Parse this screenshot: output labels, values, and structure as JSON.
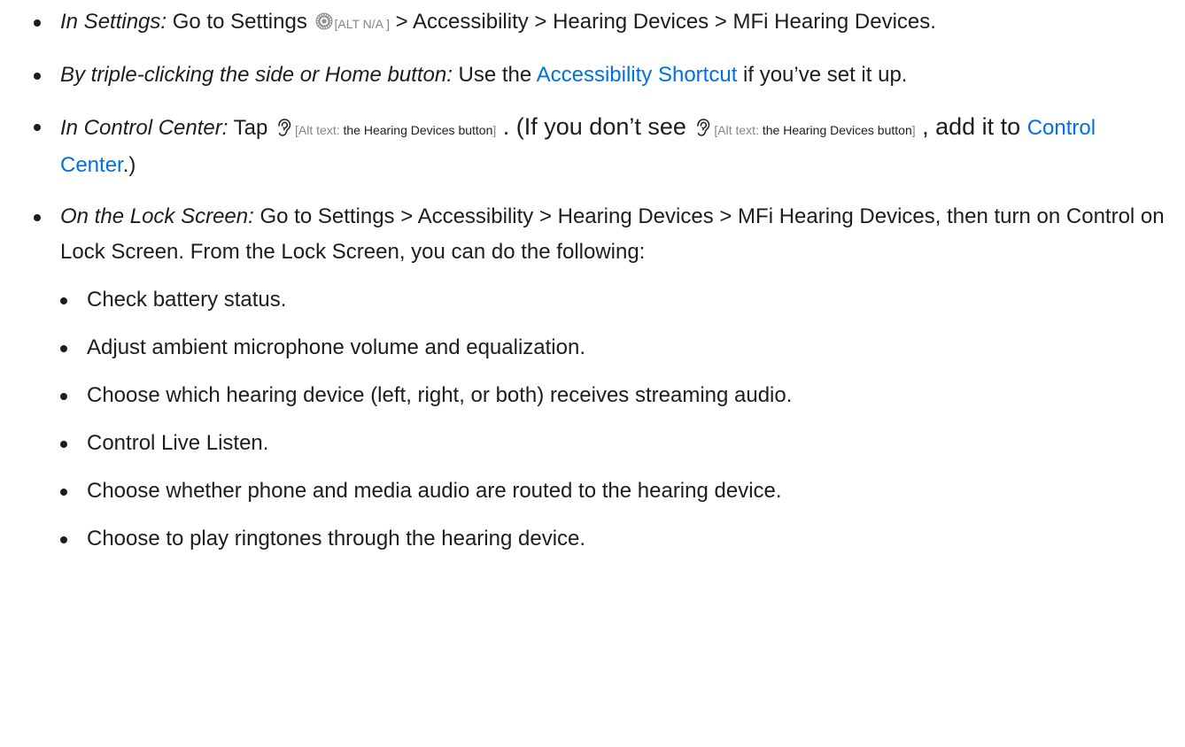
{
  "items": [
    {
      "lead": "In Settings:",
      "text_before": " Go to Settings ",
      "icon": "settings-gear-icon",
      "alt": "[ALT N/A ]",
      "text_after": " > Accessibility > Hearing Devices > MFi Hearing Devices."
    },
    {
      "lead": "By triple-clicking the side or Home button:",
      "text_before": " Use the ",
      "link": "Accessibility Shortcut",
      "text_after": " if you’ve set it up."
    },
    {
      "lead": "In Control Center:",
      "text_before": " Tap ",
      "icon": "hearing-devices-icon",
      "alt_prefix": "[Alt text: ",
      "alt_value": "the Hearing Devices button",
      "alt_suffix": "]",
      "text_mid": " . (If you don’t see ",
      "text_end": " , add it to ",
      "link": "Control Center",
      "text_after": ".)"
    },
    {
      "lead": "On the Lock Screen:",
      "text_after": " Go to Settings > Accessibility > Hearing Devices > MFi Hearing Devices, then turn on Control on Lock Screen. From the Lock Screen, you can do the following:",
      "sub_items": [
        "Check battery status.",
        "Adjust ambient microphone volume and equalization.",
        "Choose which hearing device (left, right, or both) receives streaming audio.",
        "Control Live Listen.",
        "Choose whether phone and media audio are routed to the hearing device.",
        "Choose to play ringtones through the hearing device."
      ]
    }
  ]
}
